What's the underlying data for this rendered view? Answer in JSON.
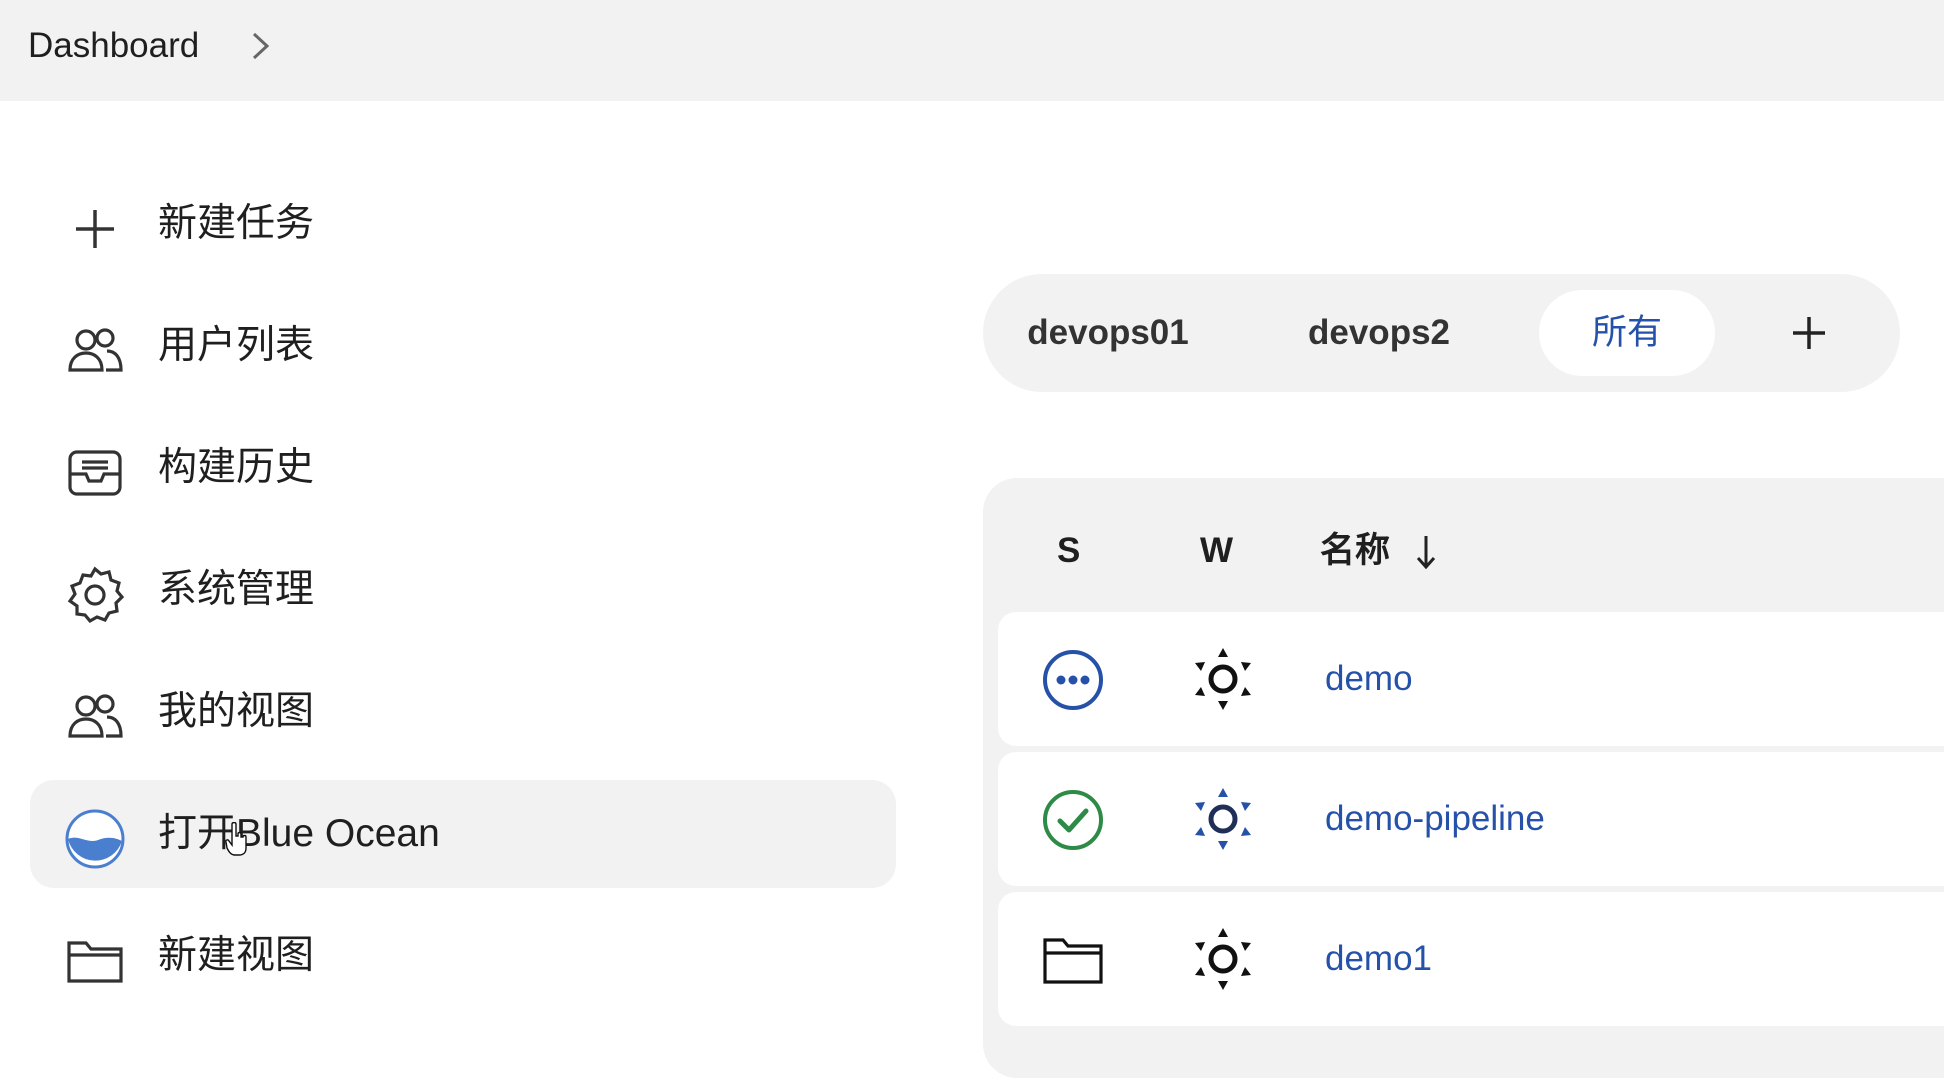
{
  "breadcrumb": {
    "root": "Dashboard"
  },
  "sidebar": {
    "items": [
      {
        "label": "新建任务",
        "icon": "plus-icon"
      },
      {
        "label": "用户列表",
        "icon": "people-icon"
      },
      {
        "label": "构建历史",
        "icon": "inbox-icon"
      },
      {
        "label": "系统管理",
        "icon": "gear-icon"
      },
      {
        "label": "我的视图",
        "icon": "people-icon"
      },
      {
        "label": "打开Blue Ocean",
        "icon": "blue-ocean-icon",
        "active": true
      },
      {
        "label": "新建视图",
        "icon": "folder-icon"
      }
    ]
  },
  "views": {
    "tabs": [
      {
        "label": "devops01"
      },
      {
        "label": "devops2"
      },
      {
        "label": "所有",
        "active": true
      }
    ],
    "add_icon": "plus-icon"
  },
  "table": {
    "headers": {
      "status": "S",
      "weather": "W",
      "name": "名称"
    },
    "sort": "descending",
    "rows": [
      {
        "name": "demo",
        "status_icon": "in-progress-icon",
        "weather_icon": "sun-icon"
      },
      {
        "name": "demo-pipeline",
        "status_icon": "success-check-icon",
        "weather_icon": "sun-icon"
      },
      {
        "name": "demo1",
        "status_icon": "folder-icon",
        "weather_icon": "sun-icon"
      }
    ]
  },
  "colors": {
    "accent": "#2552a8",
    "success": "#2e8b47",
    "panel": "#f2f2f2",
    "text": "#1f1f1f"
  }
}
